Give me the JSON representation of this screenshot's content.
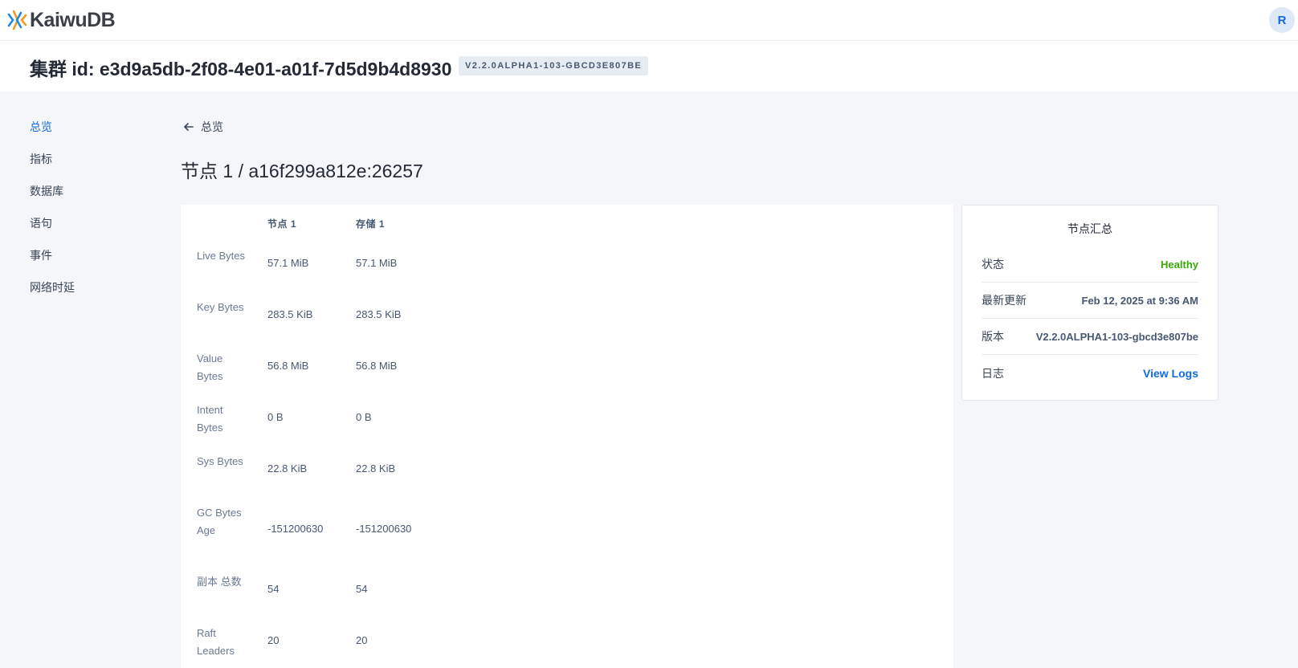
{
  "header": {
    "logo_text": "KaiwuDB",
    "avatar_letter": "R"
  },
  "cluster": {
    "title": "集群 id: e3d9a5db-2f08-4e01-a01f-7d5d9b4d8930",
    "version_badge": "V2.2.0ALPHA1-103-GBCD3E807BE"
  },
  "sidebar": {
    "items": [
      {
        "label": "总览",
        "active": true
      },
      {
        "label": "指标",
        "active": false
      },
      {
        "label": "数据库",
        "active": false
      },
      {
        "label": "语句",
        "active": false
      },
      {
        "label": "事件",
        "active": false
      },
      {
        "label": "网络时延",
        "active": false
      }
    ]
  },
  "back_link": {
    "label": "总览"
  },
  "page_title": "节点 1 / a16f299a812e:26257",
  "table": {
    "columns": [
      "节点 1",
      "存储 1"
    ],
    "rows": [
      {
        "label": "Live Bytes",
        "node": "57.1 MiB",
        "store": "57.1 MiB"
      },
      {
        "label": "Key Bytes",
        "node": "283.5 KiB",
        "store": "283.5 KiB"
      },
      {
        "label": "Value Bytes",
        "node": "56.8 MiB",
        "store": "56.8 MiB"
      },
      {
        "label": "Intent Bytes",
        "node": "0 B",
        "store": "0 B"
      },
      {
        "label": "Sys Bytes",
        "node": "22.8 KiB",
        "store": "22.8 KiB"
      },
      {
        "label": "GC Bytes Age",
        "node": "-151200630",
        "store": "-151200630"
      },
      {
        "label": "副本 总数",
        "node": "54",
        "store": "54"
      },
      {
        "label": "Raft Leaders",
        "node": "20",
        "store": "20"
      }
    ]
  },
  "summary": {
    "title": "节点汇总",
    "rows": [
      {
        "label": "状态",
        "value": "Healthy"
      },
      {
        "label": "最新更新",
        "value": "Feb 12, 2025 at 9:36 AM"
      },
      {
        "label": "版本",
        "value": "V2.2.0ALPHA1-103-gbcd3e807be"
      },
      {
        "label": "日志",
        "value": "View Logs"
      }
    ]
  },
  "colors": {
    "accent": "#0f6bdf",
    "healthy": "#37a806",
    "logo_orange": "#f29b1d",
    "logo_blue": "#1e88e5"
  }
}
